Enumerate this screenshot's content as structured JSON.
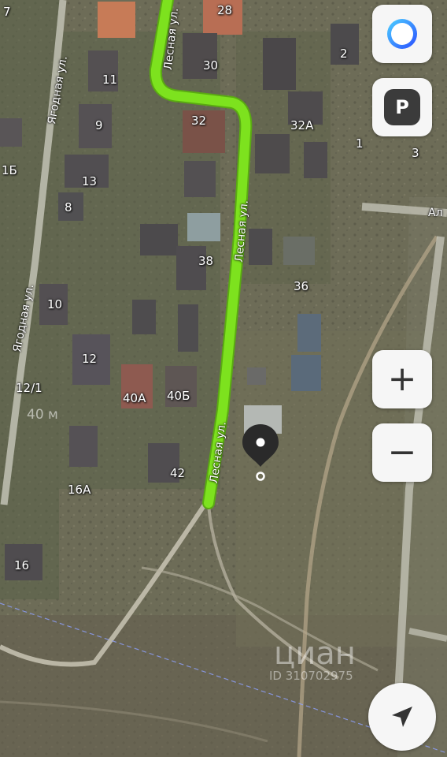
{
  "map": {
    "streets": {
      "lesnaya": "Лесная ул.",
      "yagodnaya": "Ягодная ул.",
      "al": "Ал"
    },
    "house_labels": [
      "7",
      "28",
      "30",
      "2",
      "11",
      "9",
      "32",
      "32А",
      "1",
      "3",
      "1Б",
      "13",
      "8",
      "38",
      "36",
      "10",
      "12",
      "12/1",
      "40А",
      "40Б",
      "42",
      "16А",
      "16"
    ],
    "scale_text": "40 м",
    "watermark": {
      "brand": "циан",
      "id_text": "ID 310702975"
    },
    "route_color": "#7de21e"
  },
  "controls": {
    "assistant_icon": "alice-voice-assistant-icon",
    "parking_label": "P",
    "zoom_in_label": "+",
    "zoom_out_label": "−",
    "locate_icon": "navigation-arrow-icon"
  }
}
